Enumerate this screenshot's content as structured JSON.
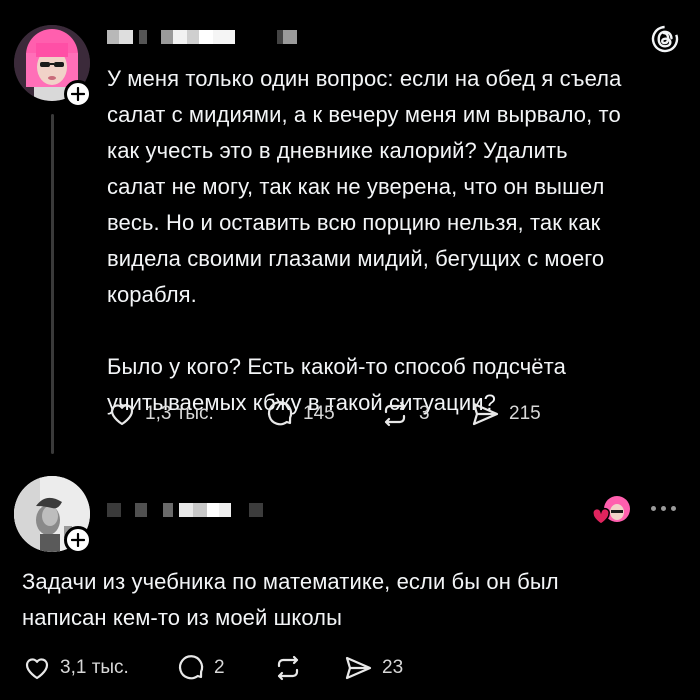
{
  "post1": {
    "text": "У меня только один вопрос: если на обед я съела\nсалат с мидиями, а к вечеру меня им вырвало, то\nкак учесть это в дневнике калорий? Удалить\nсалат не могу, так как не уверена, что он вышел\nвесь. Но и оставить всю порцию нельзя, так как\nвидела своими глазами мидий, бегущих с моего\nкорабля.\n\nБыло у кого? Есть какой-то способ подсчёта\nучитываемых кбжу в такой ситуации?",
    "likes": "1,3 тыс.",
    "replies": "145",
    "reposts": "3",
    "shares": "215"
  },
  "post2": {
    "text": "Задачи из учебника по математике, если бы он был\nнаписан кем-то из моей школы",
    "likes": "3,1 тыс.",
    "replies": "2",
    "reposts": "",
    "shares": "23"
  },
  "colors": {
    "background": "#000000",
    "text": "#f3f5f7",
    "secondary": "#d8d8d8",
    "thread_line": "#3a3a3a",
    "like_heart": "#e0245e"
  },
  "icons": [
    "threads-logo-icon",
    "heart-icon",
    "comment-icon",
    "repost-icon",
    "share-icon",
    "follow-plus-icon",
    "more-icon"
  ]
}
